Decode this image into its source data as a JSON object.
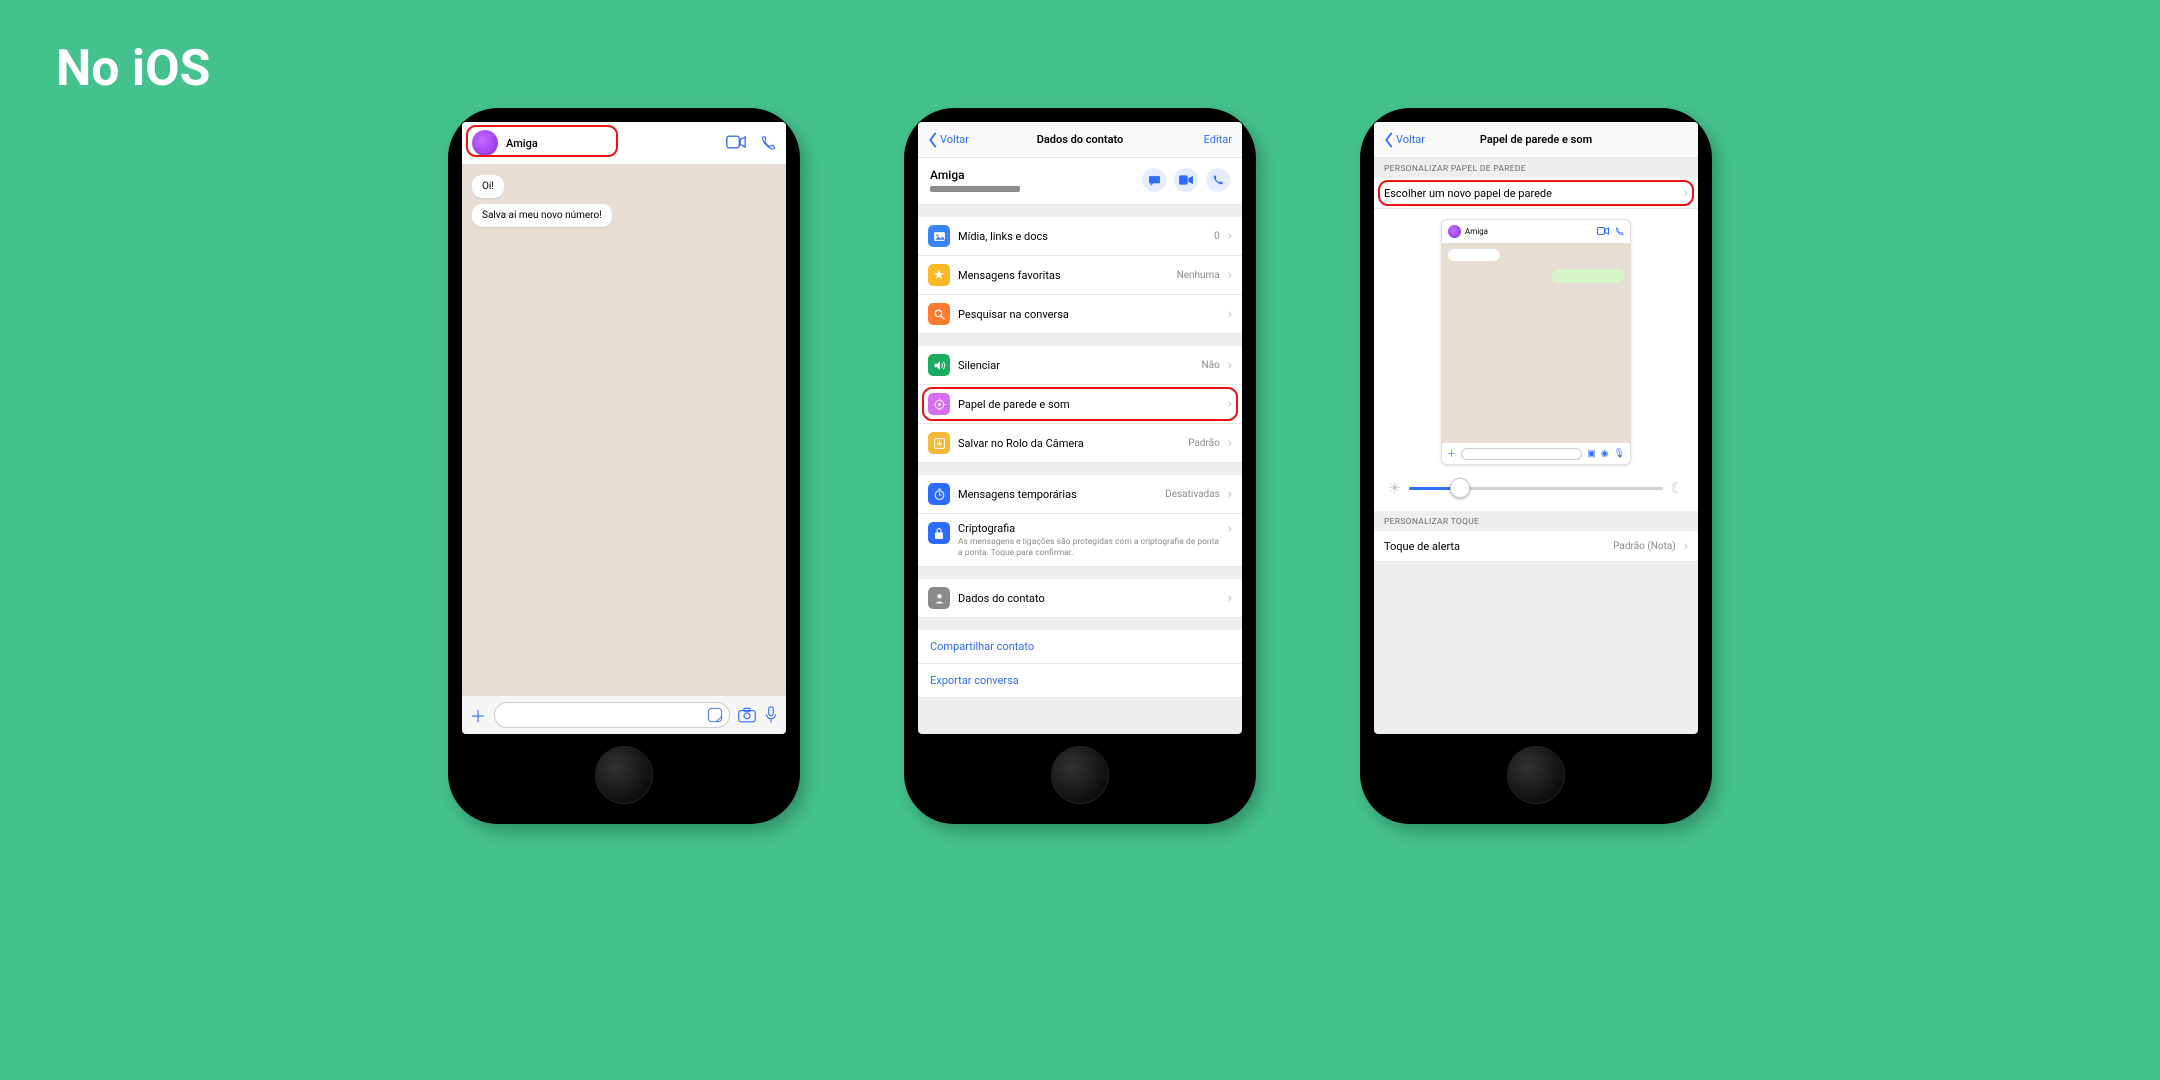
{
  "page_title": "No iOS",
  "phone1": {
    "contact_name": "Amiga",
    "messages": [
      "Oi!",
      "Salva aí meu novo número!"
    ]
  },
  "phone2": {
    "nav_back": "Voltar",
    "nav_title": "Dados do contato",
    "nav_edit": "Editar",
    "contact_name": "Amiga",
    "rows": {
      "media": {
        "label": "Mídia, links e docs",
        "value": "0"
      },
      "starred": {
        "label": "Mensagens favoritas",
        "value": "Nenhuma"
      },
      "search": {
        "label": "Pesquisar na conversa"
      },
      "mute": {
        "label": "Silenciar",
        "value": "Não"
      },
      "wallpaper": {
        "label": "Papel de parede e som"
      },
      "save_camera": {
        "label": "Salvar no Rolo da Câmera",
        "value": "Padrão"
      },
      "disappearing": {
        "label": "Mensagens temporárias",
        "value": "Desativadas"
      },
      "encryption": {
        "label": "Criptografia",
        "sub": "As mensagens e ligações são protegidas com a criptografia de ponta a ponta. Toque para confirmar."
      },
      "contact_details": {
        "label": "Dados do contato"
      }
    },
    "links": {
      "share": "Compartilhar contato",
      "export": "Exportar conversa"
    }
  },
  "phone3": {
    "nav_back": "Voltar",
    "nav_title": "Papel de parede e som",
    "section_wallpaper": "Personalizar papel de parede",
    "choose_wallpaper": "Escolher um novo papel de parede",
    "preview_name": "Amiga",
    "section_ringtone": "Personalizar toque",
    "alert_tone": {
      "label": "Toque de alerta",
      "value": "Padrão (Nota)"
    }
  }
}
